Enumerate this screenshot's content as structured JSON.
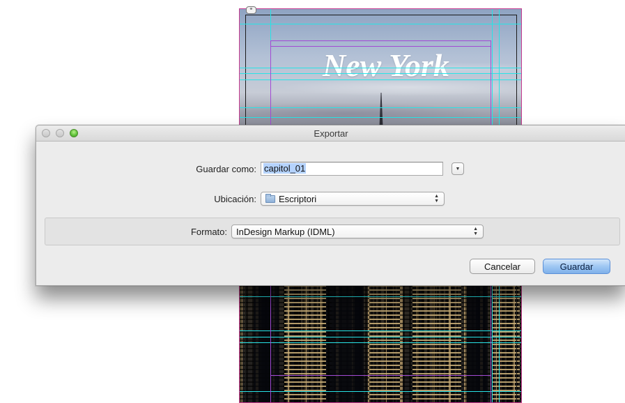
{
  "document": {
    "page_title": "New York",
    "link_badge": "⚭"
  },
  "dialog": {
    "title": "Exportar",
    "save_as": {
      "label": "Guardar como:",
      "value": "capitol_01"
    },
    "location": {
      "label": "Ubicación:",
      "value": "Escriptori"
    },
    "format": {
      "label": "Formato:",
      "value": "InDesign Markup (IDML)"
    },
    "buttons": {
      "cancel": "Cancelar",
      "save": "Guardar"
    }
  },
  "icons": {
    "expand": "triangle-down-icon",
    "popup_arrows": "up-down-arrows-icon",
    "folder": "folder-icon"
  },
  "colors": {
    "guide_cyan": "#27e3e6",
    "guide_magenta": "#a24ad4",
    "page_border": "#c63a8f",
    "default_button": "#7fb1ea",
    "selection": "#b5d3fd"
  }
}
